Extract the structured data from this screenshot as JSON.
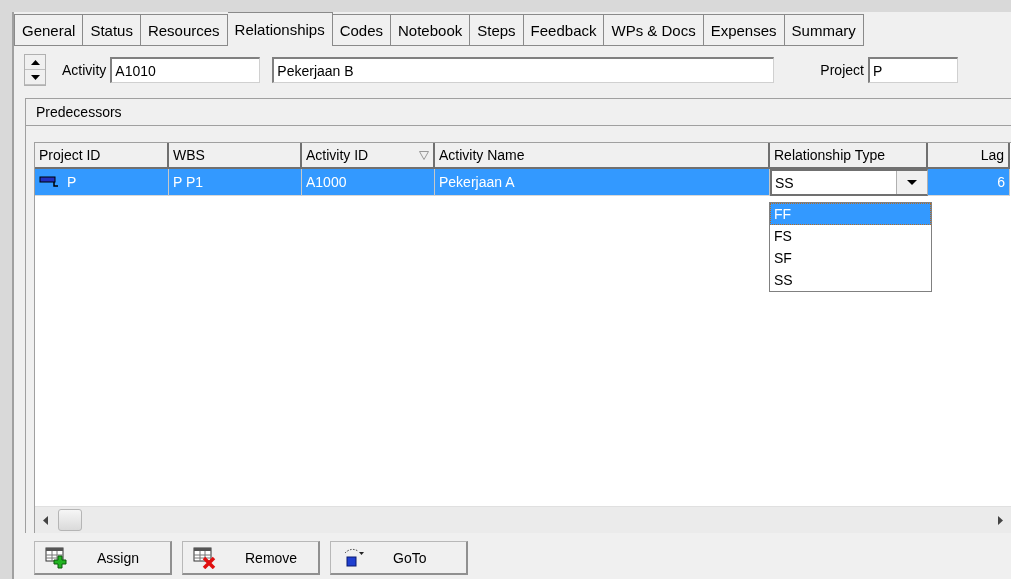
{
  "tabs": [
    {
      "label": "General",
      "selected": false
    },
    {
      "label": "Status",
      "selected": false
    },
    {
      "label": "Resources",
      "selected": false
    },
    {
      "label": "Relationships",
      "selected": true
    },
    {
      "label": "Codes",
      "selected": false
    },
    {
      "label": "Notebook",
      "selected": false
    },
    {
      "label": "Steps",
      "selected": false
    },
    {
      "label": "Feedback",
      "selected": false
    },
    {
      "label": "WPs & Docs",
      "selected": false
    },
    {
      "label": "Expenses",
      "selected": false
    },
    {
      "label": "Summary",
      "selected": false
    }
  ],
  "activity": {
    "label": "Activity",
    "id": "A1010",
    "name": "Pekerjaan B"
  },
  "project": {
    "label": "Project",
    "value": "P"
  },
  "predecessors": {
    "title": "Predecessors",
    "columns": [
      {
        "label": "Project ID",
        "kind": "text",
        "sorted": false
      },
      {
        "label": "WBS",
        "kind": "text",
        "sorted": false
      },
      {
        "label": "Activity ID",
        "kind": "text",
        "sorted": true
      },
      {
        "label": "Activity Name",
        "kind": "text",
        "sorted": false
      },
      {
        "label": "Relationship Type",
        "kind": "combo",
        "sorted": false
      },
      {
        "label": "Lag",
        "kind": "number",
        "sorted": false
      }
    ],
    "rows": [
      {
        "selected": true,
        "cells": [
          "P",
          "P P1",
          "A1000",
          "Pekerjaan A",
          "SS",
          "6"
        ]
      }
    ],
    "dropdown": {
      "options": [
        {
          "label": "FF",
          "selected": true
        },
        {
          "label": "FS",
          "selected": false
        },
        {
          "label": "SF",
          "selected": false
        },
        {
          "label": "SS",
          "selected": false
        }
      ]
    }
  },
  "buttons": [
    {
      "label": "Assign",
      "kind": "assign"
    },
    {
      "label": "Remove",
      "kind": "remove"
    },
    {
      "label": "GoTo",
      "kind": "goto"
    }
  ]
}
